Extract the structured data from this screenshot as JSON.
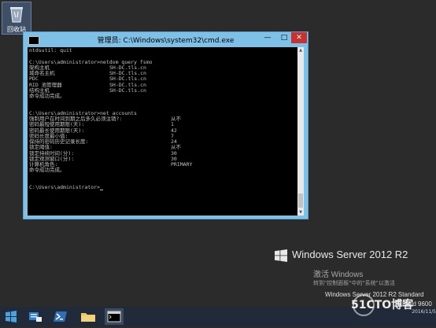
{
  "desktop": {
    "recycle_bin_label": "回收站"
  },
  "window": {
    "title": "管理员: C:\\Windows\\system32\\cmd.exe",
    "minimize_glyph": "—",
    "maximize_glyph": "□",
    "close_glyph": "✕",
    "scroll_up_glyph": "▲",
    "scroll_down_glyph": "▼"
  },
  "console": {
    "lines": [
      {
        "text": "ntdsutil: quit"
      },
      {
        "text": ""
      },
      {
        "text": "C:\\Users\\administrator>netdom query fsmo"
      },
      {
        "text": "架构主机",
        "value": "SH-DC.tls.cn"
      },
      {
        "text": "域命名主机",
        "value": "SH-DC.tls.cn"
      },
      {
        "text": "PDC",
        "value": "SH-DC.tls.cn"
      },
      {
        "text": "RID 池管理器",
        "value": "SH-DC.tls.cn"
      },
      {
        "text": "结构主机",
        "value": "SH-DC.tls.cn"
      },
      {
        "text": "命令成功完成。"
      },
      {
        "text": ""
      },
      {
        "text": ""
      },
      {
        "text": "C:\\Users\\administrator>net accounts"
      },
      {
        "text": "强制用户在时间到期之后多久必须注销?:",
        "value": "从不"
      },
      {
        "text": "密码最短使用期限(天):",
        "value": "1"
      },
      {
        "text": "密码最长使用期限(天):",
        "value": "42"
      },
      {
        "text": "密码长度最小值:",
        "value": "7"
      },
      {
        "text": "保持的密码历史记录长度:",
        "value": "24"
      },
      {
        "text": "锁定阈值:",
        "value": "从不"
      },
      {
        "text": "锁定持续时间(分):",
        "value": "30"
      },
      {
        "text": "锁定观测窗口(分):",
        "value": "30"
      },
      {
        "text": "计算机角色:",
        "value": "PRIMARY"
      },
      {
        "text": "命令成功完成。"
      },
      {
        "text": ""
      },
      {
        "text": ""
      },
      {
        "text": "C:\\Users\\administrator>"
      }
    ]
  },
  "desktop_watermark": {
    "brand": "Windows Server 2012 R2",
    "activate_title": "激活 Windows",
    "activate_subtitle": "转到\"控制面板\"中的\"系统\"以激活",
    "edition": "Windows Server 2012 R2 Standard",
    "build": "Build 9600"
  },
  "site_watermark": "51CTO博客",
  "taskbar": {
    "date": "2016/11/5"
  }
}
